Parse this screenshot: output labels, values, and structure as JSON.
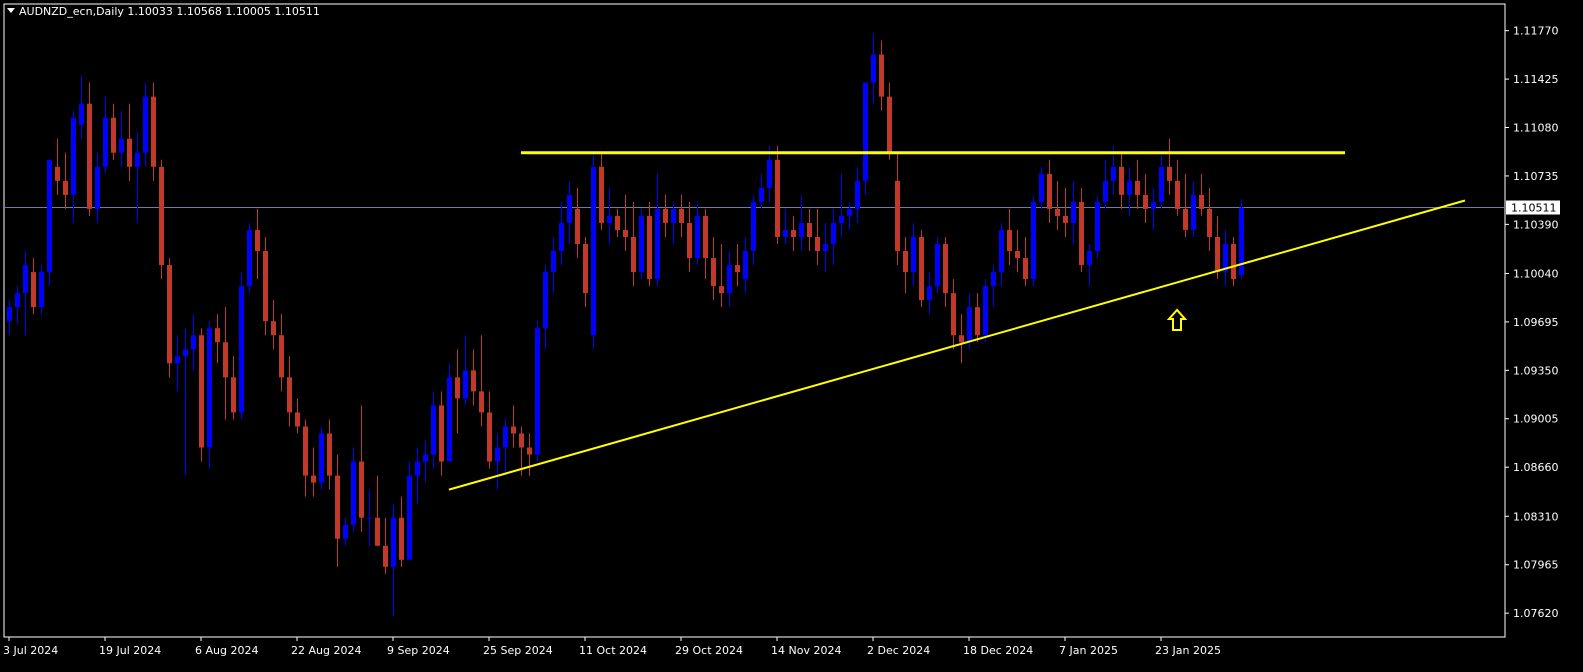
{
  "header": {
    "symbol_line": "AUDNZD_ecn,Daily  1.10033 1.10568 1.10005 1.10511"
  },
  "colors": {
    "background": "#000000",
    "frame": "#ffffff",
    "bull": "#0000ff",
    "bear": "#c0392b",
    "trendline": "#ffff00",
    "price_line": "#6b7fa3",
    "text": "#ffffff"
  },
  "icons": {
    "marker": "up-arrow-icon"
  },
  "chart_data": {
    "type": "candlestick",
    "symbol": "AUDNZD_ecn",
    "timeframe": "Daily",
    "ohlc_last": {
      "open": 1.10033,
      "high": 1.10568,
      "low": 1.10005,
      "close": 1.10511
    },
    "current_price_label": "1.10511",
    "ylim": [
      1.0745,
      1.1196
    ],
    "y_ticks": [
      "1.11770",
      "1.11425",
      "1.11080",
      "1.10735",
      "1.10390",
      "1.10040",
      "1.09695",
      "1.09350",
      "1.09005",
      "1.08660",
      "1.08310",
      "1.07965",
      "1.07620"
    ],
    "x_ticks": [
      {
        "label": "3 Jul 2024",
        "i": 0
      },
      {
        "label": "19 Jul 2024",
        "i": 12
      },
      {
        "label": "6 Aug 2024",
        "i": 24
      },
      {
        "label": "22 Aug 2024",
        "i": 36
      },
      {
        "label": "9 Sep 2024",
        "i": 48
      },
      {
        "label": "25 Sep 2024",
        "i": 60
      },
      {
        "label": "11 Oct 2024",
        "i": 72
      },
      {
        "label": "29 Oct 2024",
        "i": 84
      },
      {
        "label": "14 Nov 2024",
        "i": 96
      },
      {
        "label": "2 Dec 2024",
        "i": 108
      },
      {
        "label": "18 Dec 2024",
        "i": 120
      },
      {
        "label": "7 Jan 2025",
        "i": 132
      },
      {
        "label": "23 Jan 2025",
        "i": 144
      }
    ],
    "candles": [
      [
        1.097,
        1.0985,
        1.096,
        1.098
      ],
      [
        1.098,
        1.0995,
        1.0968,
        1.099
      ],
      [
        1.099,
        1.102,
        1.096,
        1.101
      ],
      [
        1.1005,
        1.1015,
        1.0975,
        1.098
      ],
      [
        1.098,
        1.101,
        1.0975,
        1.1005
      ],
      [
        1.1005,
        1.108,
        1.0995,
        1.1085
      ],
      [
        1.108,
        1.11,
        1.106,
        1.107
      ],
      [
        1.107,
        1.109,
        1.105,
        1.106
      ],
      [
        1.106,
        1.112,
        1.104,
        1.1115
      ],
      [
        1.111,
        1.1145,
        1.11,
        1.1125
      ],
      [
        1.1125,
        1.114,
        1.1045,
        1.105
      ],
      [
        1.105,
        1.109,
        1.104,
        1.108
      ],
      [
        1.108,
        1.113,
        1.1075,
        1.1115
      ],
      [
        1.1115,
        1.1125,
        1.1085,
        1.109
      ],
      [
        1.109,
        1.112,
        1.108,
        1.11
      ],
      [
        1.11,
        1.1125,
        1.107,
        1.108
      ],
      [
        1.108,
        1.1105,
        1.104,
        1.109
      ],
      [
        1.109,
        1.114,
        1.108,
        1.113
      ],
      [
        1.113,
        1.114,
        1.107,
        1.108
      ],
      [
        1.108,
        1.1085,
        1.1,
        1.101
      ],
      [
        1.101,
        1.1015,
        1.093,
        1.094
      ],
      [
        1.094,
        1.096,
        1.092,
        1.0945
      ],
      [
        1.0945,
        1.0965,
        1.086,
        1.095
      ],
      [
        1.095,
        1.0975,
        1.0935,
        1.096
      ],
      [
        1.096,
        1.0965,
        1.087,
        1.088
      ],
      [
        1.088,
        1.097,
        1.0865,
        1.0965
      ],
      [
        1.0965,
        1.0975,
        1.094,
        1.0955
      ],
      [
        1.0955,
        1.098,
        1.09,
        1.093
      ],
      [
        1.093,
        1.0945,
        1.09,
        1.0905
      ],
      [
        1.0905,
        1.1005,
        1.09,
        1.0995
      ],
      [
        1.0995,
        1.104,
        1.099,
        1.1035
      ],
      [
        1.1035,
        1.105,
        1.1,
        1.102
      ],
      [
        1.102,
        1.103,
        1.096,
        1.097
      ],
      [
        1.097,
        1.0985,
        1.095,
        1.096
      ],
      [
        1.096,
        1.0975,
        1.092,
        1.093
      ],
      [
        1.093,
        1.0945,
        1.0895,
        1.0905
      ],
      [
        1.0905,
        1.0915,
        1.089,
        1.0895
      ],
      [
        1.0895,
        1.09,
        1.0845,
        1.086
      ],
      [
        1.086,
        1.088,
        1.0845,
        1.0855
      ],
      [
        1.0855,
        1.0895,
        1.085,
        1.089
      ],
      [
        1.089,
        1.09,
        1.085,
        1.086
      ],
      [
        1.086,
        1.0875,
        1.0795,
        1.0815
      ],
      [
        1.0815,
        1.083,
        1.081,
        1.0825
      ],
      [
        1.0825,
        1.088,
        1.082,
        1.087
      ],
      [
        1.087,
        1.091,
        1.082,
        1.083
      ],
      [
        1.083,
        1.085,
        1.081,
        1.083
      ],
      [
        1.083,
        1.086,
        1.081,
        1.081
      ],
      [
        1.081,
        1.083,
        1.079,
        1.0795
      ],
      [
        1.0795,
        1.084,
        1.076,
        1.083
      ],
      [
        1.083,
        1.0845,
        1.0795,
        1.08
      ],
      [
        1.08,
        1.087,
        1.08,
        1.086
      ],
      [
        1.086,
        1.088,
        1.084,
        1.087
      ],
      [
        1.087,
        1.0885,
        1.0855,
        1.0875
      ],
      [
        1.0875,
        1.092,
        1.0865,
        1.091
      ],
      [
        1.091,
        1.092,
        1.086,
        1.087
      ],
      [
        1.087,
        1.094,
        1.087,
        1.093
      ],
      [
        1.093,
        1.095,
        1.089,
        1.0915
      ],
      [
        1.0915,
        1.096,
        1.091,
        1.0935
      ],
      [
        1.0935,
        1.095,
        1.091,
        1.092
      ],
      [
        1.092,
        1.096,
        1.0895,
        1.0905
      ],
      [
        1.0905,
        1.092,
        1.0865,
        1.087
      ],
      [
        1.087,
        1.089,
        1.085,
        1.088
      ],
      [
        1.088,
        1.09,
        1.086,
        1.0895
      ],
      [
        1.0895,
        1.091,
        1.088,
        1.089
      ],
      [
        1.089,
        1.0895,
        1.086,
        1.088
      ],
      [
        1.088,
        1.089,
        1.086,
        1.0875
      ],
      [
        1.0875,
        1.097,
        1.087,
        1.0965
      ],
      [
        1.0965,
        1.101,
        1.095,
        1.1005
      ],
      [
        1.1005,
        1.103,
        1.099,
        1.102
      ],
      [
        1.102,
        1.1055,
        1.101,
        1.104
      ],
      [
        1.104,
        1.107,
        1.1025,
        1.106
      ],
      [
        1.105,
        1.1065,
        1.1015,
        1.1025
      ],
      [
        1.1025,
        1.103,
        1.098,
        1.099
      ],
      [
        1.096,
        1.109,
        1.095,
        1.108
      ],
      [
        1.108,
        1.109,
        1.1035,
        1.104
      ],
      [
        1.104,
        1.1065,
        1.1025,
        1.1045
      ],
      [
        1.1045,
        1.105,
        1.103,
        1.1035
      ],
      [
        1.1035,
        1.106,
        1.102,
        1.103
      ],
      [
        1.103,
        1.1055,
        1.0995,
        1.1005
      ],
      [
        1.1005,
        1.105,
        1.1,
        1.1045
      ],
      [
        1.1045,
        1.1055,
        1.0995,
        1.1
      ],
      [
        1.1,
        1.1075,
        1.0995,
        1.105
      ],
      [
        1.105,
        1.106,
        1.103,
        1.104
      ],
      [
        1.104,
        1.1055,
        1.1025,
        1.105
      ],
      [
        1.105,
        1.106,
        1.103,
        1.104
      ],
      [
        1.104,
        1.1055,
        1.1005,
        1.1015
      ],
      [
        1.1015,
        1.1055,
        1.101,
        1.1045
      ],
      [
        1.1045,
        1.105,
        1.1,
        1.1015
      ],
      [
        1.1015,
        1.103,
        1.0985,
        1.0995
      ],
      [
        1.0995,
        1.1025,
        1.098,
        1.099
      ],
      [
        1.099,
        1.102,
        1.098,
        1.101
      ],
      [
        1.101,
        1.1025,
        1.0995,
        1.1005
      ],
      [
        1.1,
        1.103,
        1.099,
        1.102
      ],
      [
        1.102,
        1.106,
        1.101,
        1.1055
      ],
      [
        1.1055,
        1.1075,
        1.105,
        1.1065
      ],
      [
        1.1065,
        1.1095,
        1.1055,
        1.1085
      ],
      [
        1.1085,
        1.1095,
        1.1025,
        1.103
      ],
      [
        1.103,
        1.105,
        1.1025,
        1.1035
      ],
      [
        1.1035,
        1.1045,
        1.102,
        1.103
      ],
      [
        1.103,
        1.106,
        1.102,
        1.104
      ],
      [
        1.104,
        1.105,
        1.102,
        1.103
      ],
      [
        1.103,
        1.105,
        1.101,
        1.102
      ],
      [
        1.102,
        1.104,
        1.1005,
        1.1025
      ],
      [
        1.1025,
        1.105,
        1.101,
        1.104
      ],
      [
        1.104,
        1.1075,
        1.103,
        1.1045
      ],
      [
        1.1045,
        1.1055,
        1.1035,
        1.105
      ],
      [
        1.105,
        1.108,
        1.104,
        1.107
      ],
      [
        1.107,
        1.111,
        1.106,
        1.114
      ],
      [
        1.114,
        1.1175,
        1.1125,
        1.116
      ],
      [
        1.116,
        1.117,
        1.112,
        1.113
      ],
      [
        1.113,
        1.114,
        1.1085,
        1.109
      ],
      [
        1.107,
        1.109,
        1.101,
        1.102
      ],
      [
        1.102,
        1.103,
        1.099,
        1.1005
      ],
      [
        1.1005,
        1.104,
        1.0995,
        1.103
      ],
      [
        1.103,
        1.1035,
        1.098,
        1.0985
      ],
      [
        1.0985,
        1.1005,
        1.0975,
        1.0995
      ],
      [
        1.0995,
        1.103,
        1.099,
        1.1025
      ],
      [
        1.1025,
        1.103,
        1.098,
        1.099
      ],
      [
        1.099,
        1.1,
        1.095,
        1.096
      ],
      [
        1.096,
        1.0975,
        1.094,
        1.0955
      ],
      [
        1.0955,
        1.099,
        1.095,
        1.098
      ],
      [
        1.098,
        1.099,
        1.0955,
        1.096
      ],
      [
        1.096,
        1.1,
        1.0955,
        1.0995
      ],
      [
        1.0995,
        1.101,
        1.098,
        1.1005
      ],
      [
        1.1005,
        1.104,
        1.0995,
        1.1035
      ],
      [
        1.1035,
        1.105,
        1.101,
        1.102
      ],
      [
        1.102,
        1.1035,
        1.1005,
        1.1015
      ],
      [
        1.1015,
        1.103,
        1.0995,
        1.1
      ],
      [
        1.1,
        1.106,
        1.0995,
        1.1055
      ],
      [
        1.1055,
        1.108,
        1.105,
        1.1075
      ],
      [
        1.1075,
        1.1085,
        1.104,
        1.105
      ],
      [
        1.105,
        1.107,
        1.1035,
        1.1045
      ],
      [
        1.1045,
        1.1065,
        1.103,
        1.104
      ],
      [
        1.104,
        1.107,
        1.1025,
        1.1055
      ],
      [
        1.1055,
        1.1065,
        1.1005,
        1.101
      ],
      [
        1.101,
        1.1025,
        1.0995,
        1.102
      ],
      [
        1.102,
        1.106,
        1.1015,
        1.1055
      ],
      [
        1.1055,
        1.1085,
        1.105,
        1.107
      ],
      [
        1.107,
        1.1095,
        1.106,
        1.108
      ],
      [
        1.108,
        1.109,
        1.105,
        1.106
      ],
      [
        1.106,
        1.108,
        1.1045,
        1.107
      ],
      [
        1.107,
        1.1085,
        1.105,
        1.106
      ],
      [
        1.106,
        1.1075,
        1.104,
        1.105
      ],
      [
        1.105,
        1.1065,
        1.1035,
        1.1055
      ],
      [
        1.1055,
        1.109,
        1.105,
        1.108
      ],
      [
        1.108,
        1.11,
        1.106,
        1.107
      ],
      [
        1.107,
        1.1085,
        1.1045,
        1.105
      ],
      [
        1.105,
        1.1075,
        1.103,
        1.1035
      ],
      [
        1.1035,
        1.107,
        1.103,
        1.106
      ],
      [
        1.106,
        1.1075,
        1.1045,
        1.105
      ],
      [
        1.105,
        1.1065,
        1.102,
        1.103
      ],
      [
        1.103,
        1.1045,
        1.1,
        1.1005
      ],
      [
        1.1005,
        1.1035,
        1.0995,
        1.1025
      ],
      [
        1.1025,
        1.103,
        1.0995,
        1.1
      ],
      [
        1.1003,
        1.1057,
        1.1,
        1.1051
      ]
    ],
    "lines": [
      {
        "name": "resistance",
        "p1": {
          "i": 64,
          "price": 1.109
        },
        "p2": {
          "i": 167,
          "price": 1.109
        }
      },
      {
        "name": "support-trendline",
        "p1": {
          "i": 55,
          "price": 1.085
        },
        "p2": {
          "i": 182,
          "price": 1.1056
        }
      }
    ],
    "marker": {
      "type": "up-arrow",
      "i": 146,
      "price": 1.0978
    },
    "grid": false
  }
}
